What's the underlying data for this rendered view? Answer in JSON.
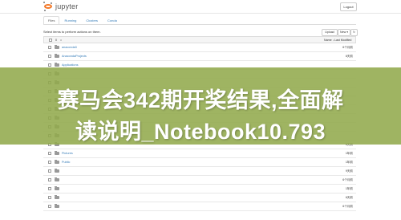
{
  "header": {
    "logo_text": "jupyter",
    "logout_label": "Logout"
  },
  "tabs": [
    {
      "label": "Files"
    },
    {
      "label": "Running"
    },
    {
      "label": "Clusters"
    },
    {
      "label": "Conda"
    }
  ],
  "toolbar": {
    "hint": "Select items to perform actions on them.",
    "upload_label": "Upload",
    "new_label": "New ▾",
    "refresh_label": "↻"
  },
  "file_header": {
    "count": "0",
    "path_icon": "home-icon",
    "name_label": "Name ↓",
    "modified_label": "Last Modified"
  },
  "rows": [
    {
      "name": "anaconda3",
      "modified": "6个月前"
    },
    {
      "name": "AnacondaProjects",
      "modified": "6天前"
    },
    {
      "name": "Applications",
      "modified": ""
    },
    {
      "name": "",
      "modified": ""
    },
    {
      "name": "",
      "modified": ""
    },
    {
      "name": "",
      "modified": ""
    },
    {
      "name": "",
      "modified": ""
    },
    {
      "name": "",
      "modified": ""
    },
    {
      "name": "",
      "modified": ""
    },
    {
      "name": "",
      "modified": ""
    },
    {
      "name": "",
      "modified": ""
    },
    {
      "name": "",
      "modified": "6天前"
    },
    {
      "name": "Pictures",
      "modified": "1年前"
    },
    {
      "name": "Public",
      "modified": "1年前"
    },
    {
      "name": "",
      "modified": "9天前"
    },
    {
      "name": "",
      "modified": "6个月前"
    },
    {
      "name": "",
      "modified": "1年前"
    },
    {
      "name": "",
      "modified": "6天前"
    },
    {
      "name": "",
      "modified": "6个月前"
    }
  ],
  "banner": {
    "line1": "赛马会342期开奖结果,全面解",
    "line2": "读说明_Notebook10.793",
    "color": "#92aa4c"
  }
}
